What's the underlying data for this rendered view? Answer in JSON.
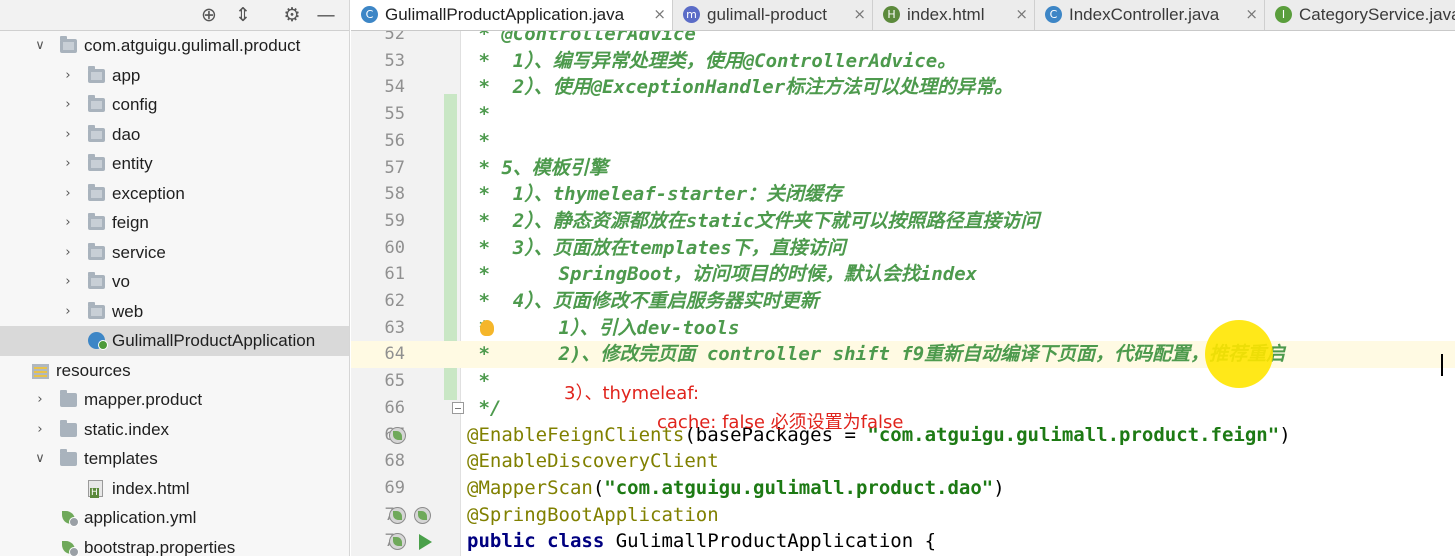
{
  "project": {
    "toolbar_icons": [
      "globe-icon",
      "collapse-icon",
      "gear-icon",
      "minimize-icon"
    ],
    "tree": [
      {
        "label": "com.atguigu.gulimall.product",
        "indent": 0,
        "arrow": "down",
        "icon": "package-icon"
      },
      {
        "label": "app",
        "indent": 1,
        "arrow": "right",
        "icon": "package-icon"
      },
      {
        "label": "config",
        "indent": 1,
        "arrow": "right",
        "icon": "package-icon"
      },
      {
        "label": "dao",
        "indent": 1,
        "arrow": "right",
        "icon": "package-icon"
      },
      {
        "label": "entity",
        "indent": 1,
        "arrow": "right",
        "icon": "package-icon"
      },
      {
        "label": "exception",
        "indent": 1,
        "arrow": "right",
        "icon": "package-icon"
      },
      {
        "label": "feign",
        "indent": 1,
        "arrow": "right",
        "icon": "package-icon"
      },
      {
        "label": "service",
        "indent": 1,
        "arrow": "right",
        "icon": "package-icon"
      },
      {
        "label": "vo",
        "indent": 1,
        "arrow": "right",
        "icon": "package-icon"
      },
      {
        "label": "web",
        "indent": 1,
        "arrow": "right",
        "icon": "package-icon"
      },
      {
        "label": "GulimallProductApplication",
        "indent": 1,
        "arrow": "",
        "icon": "spring-class-icon",
        "selected": true
      },
      {
        "label": "resources",
        "indent": -1,
        "arrow": "",
        "icon": "resources-folder-icon"
      },
      {
        "label": "mapper.product",
        "indent": 0,
        "arrow": "right",
        "icon": "folder-icon"
      },
      {
        "label": "static.index",
        "indent": 0,
        "arrow": "right",
        "icon": "folder-icon"
      },
      {
        "label": "templates",
        "indent": 0,
        "arrow": "down",
        "icon": "folder-icon"
      },
      {
        "label": "index.html",
        "indent": 1,
        "arrow": "",
        "icon": "html-file-icon"
      },
      {
        "label": "application.yml",
        "indent": 0,
        "arrow": "",
        "icon": "yml-file-icon"
      },
      {
        "label": "bootstrap.properties",
        "indent": 0,
        "arrow": "",
        "icon": "properties-file-icon"
      }
    ]
  },
  "tabs": [
    {
      "label": "GulimallProductApplication.java",
      "icon": "spring-class-icon",
      "icon_text": "C",
      "icon_color": "#3d86c6",
      "active": true
    },
    {
      "label": "gulimall-product",
      "icon": "maven-icon",
      "icon_text": "m",
      "icon_color": "#5b6cc7",
      "active": false
    },
    {
      "label": "index.html",
      "icon": "html-file-icon",
      "icon_text": "H",
      "icon_color": "#5c8a3c",
      "active": false
    },
    {
      "label": "IndexController.java",
      "icon": "class-icon",
      "icon_text": "C",
      "icon_color": "#3d86c6",
      "active": false
    },
    {
      "label": "CategoryService.java",
      "icon": "interface-icon",
      "icon_text": "I",
      "icon_color": "#5a9e3c",
      "active": false
    }
  ],
  "close_glyph": "×",
  "editor": {
    "current_line": 64,
    "lines": [
      {
        "n": "52",
        "parts": [
          {
            "t": " * @ControllerAdvice",
            "c": "cmt"
          }
        ]
      },
      {
        "n": "53",
        "parts": [
          {
            "t": " *  1）、编写异常处理类，使用@ControllerAdvice。",
            "c": "cmt"
          }
        ]
      },
      {
        "n": "54",
        "parts": [
          {
            "t": " *  2）、使用@ExceptionHandler标注方法可以处理的异常。",
            "c": "cmt"
          }
        ]
      },
      {
        "n": "55",
        "parts": [
          {
            "t": " *",
            "c": "cmt"
          }
        ]
      },
      {
        "n": "56",
        "parts": [
          {
            "t": " *",
            "c": "cmt"
          }
        ]
      },
      {
        "n": "57",
        "parts": [
          {
            "t": " * 5、模板引擎",
            "c": "cmt"
          }
        ]
      },
      {
        "n": "58",
        "parts": [
          {
            "t": " *  1）、thymeleaf-starter：关闭缓存",
            "c": "cmt"
          }
        ]
      },
      {
        "n": "59",
        "parts": [
          {
            "t": " *  2）、静态资源都放在static文件夹下就可以按照路径直接访问",
            "c": "cmt"
          }
        ]
      },
      {
        "n": "60",
        "parts": [
          {
            "t": " *  3）、页面放在templates下，直接访问",
            "c": "cmt"
          }
        ]
      },
      {
        "n": "61",
        "parts": [
          {
            "t": " *      SpringBoot，访问项目的时候，默认会找index",
            "c": "cmt"
          }
        ]
      },
      {
        "n": "62",
        "parts": [
          {
            "t": " *  4）、页面修改不重启服务器实时更新",
            "c": "cmt"
          }
        ]
      },
      {
        "n": "63",
        "parts": [
          {
            "t": " *      1）、引入dev-tools",
            "c": "cmt"
          }
        ]
      },
      {
        "n": "64",
        "parts": [
          {
            "t": " *      2)、修改完页面 controller shift f9重新自动编译下页面，代码配置，推荐重启",
            "c": "cmt"
          }
        ]
      },
      {
        "n": "65",
        "parts": [
          {
            "t": " *",
            "c": "cmt"
          }
        ]
      },
      {
        "n": "66",
        "parts": [
          {
            "t": " */",
            "c": "cmt"
          }
        ]
      },
      {
        "n": "67",
        "parts": [
          {
            "t": "@EnableFeignClients",
            "c": "ann"
          },
          {
            "t": "(basePackages = ",
            "c": ""
          },
          {
            "t": "\"com.atguigu.gulimall.product.feign\"",
            "c": "str"
          },
          {
            "t": ")",
            "c": ""
          }
        ]
      },
      {
        "n": "68",
        "parts": [
          {
            "t": "@EnableDiscoveryClient",
            "c": "ann"
          }
        ]
      },
      {
        "n": "69",
        "parts": [
          {
            "t": "@MapperScan",
            "c": "ann"
          },
          {
            "t": "(",
            "c": ""
          },
          {
            "t": "\"com.atguigu.gulimall.product.dao\"",
            "c": "str"
          },
          {
            "t": ")",
            "c": ""
          }
        ]
      },
      {
        "n": "70",
        "parts": [
          {
            "t": "@SpringBootApplication",
            "c": "ann"
          }
        ]
      },
      {
        "n": "71",
        "parts": [
          {
            "t": "public class ",
            "c": "kw"
          },
          {
            "t": "GulimallProductApplication {",
            "c": ""
          }
        ]
      }
    ],
    "overlay_note_1": "3）、thymeleaf:",
    "overlay_note_2": "cache: false  必须设置为false"
  }
}
